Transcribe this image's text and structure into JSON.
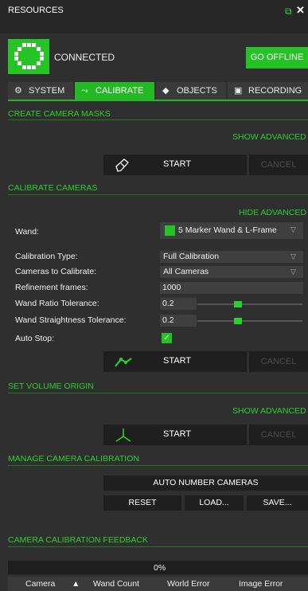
{
  "window": {
    "title": "RESOURCES",
    "pin_icon": "pin-icon",
    "close_icon": "close-icon"
  },
  "connection": {
    "status": "CONNECTED",
    "go_offline": "GO OFFLINE"
  },
  "tabs": [
    {
      "label": "SYSTEM",
      "icon": "chip-icon",
      "active": false
    },
    {
      "label": "CALIBRATE",
      "icon": "wand-icon",
      "active": true
    },
    {
      "label": "OBJECTS",
      "icon": "diamond-icon",
      "active": false
    },
    {
      "label": "RECORDING",
      "icon": "camera-icon",
      "active": false
    }
  ],
  "sections": {
    "masks": {
      "title": "CREATE CAMERA MASKS",
      "advanced": "SHOW ADVANCED",
      "start": "START",
      "cancel": "CANCEL"
    },
    "calibrate": {
      "title": "CALIBRATE CAMERAS",
      "advanced": "HIDE ADVANCED",
      "wand_label": "Wand:",
      "wand_value": "5 Marker Wand & L-Frame",
      "calibration_type_label": "Calibration Type:",
      "calibration_type_value": "Full Calibration",
      "cameras_label": "Cameras to Calibrate:",
      "cameras_value": "All Cameras",
      "refinement_label": "Refinement frames:",
      "refinement_value": "1000",
      "ratio_label": "Wand Ratio Tolerance:",
      "ratio_value": "0.2",
      "straightness_label": "Wand Straightness Tolerance:",
      "straightness_value": "0.2",
      "autostop_label": "Auto Stop:",
      "autostop_checked": true,
      "start": "START",
      "cancel": "CANCEL"
    },
    "origin": {
      "title": "SET VOLUME ORIGIN",
      "advanced": "SHOW ADVANCED",
      "start": "START",
      "cancel": "CANCEL"
    },
    "manage": {
      "title": "MANAGE CAMERA CALIBRATION",
      "auto_number": "AUTO NUMBER CAMERAS",
      "reset": "RESET",
      "load": "LOAD...",
      "save": "SAVE..."
    },
    "feedback": {
      "title": "CAMERA CALIBRATION FEEDBACK",
      "progress": "0%",
      "columns": [
        "Camera",
        "Wand Count",
        "World Error",
        "Image Error"
      ]
    }
  },
  "colors": {
    "accent": "#24b924",
    "section_text": "#2bd02b",
    "background": "#2f2f2f"
  }
}
